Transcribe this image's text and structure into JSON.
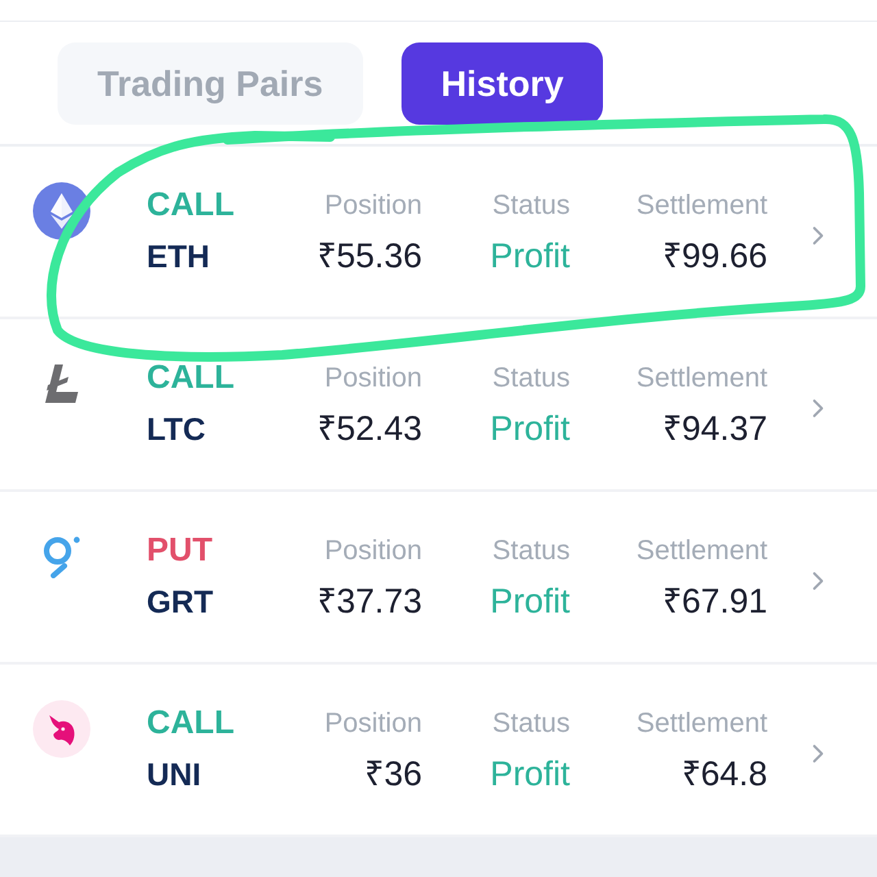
{
  "tabs": [
    {
      "label": "Trading Pairs",
      "selected": false
    },
    {
      "label": "History",
      "selected": true
    }
  ],
  "history": [
    {
      "kind": "diamond",
      "side": {
        "label": "CALL",
        "kind": "call"
      },
      "symbol": "ETH",
      "position_label": "Position",
      "position": "₹55.36",
      "status_label": "Status",
      "status": "Profit",
      "settlement_label": "Settlement",
      "settlement": "₹99.66",
      "highlighted": true
    },
    {
      "kind": "struck",
      "side": {
        "label": "CALL",
        "kind": "call"
      },
      "symbol": "LTC",
      "position_label": "Position",
      "position": "₹52.43",
      "status_label": "Status",
      "status": "Profit",
      "settlement_label": "Settlement",
      "settlement": "₹94.37",
      "highlighted": false
    },
    {
      "kind": "ring",
      "side": {
        "label": "PUT",
        "kind": "put"
      },
      "symbol": "GRT",
      "position_label": "Position",
      "position": "₹37.73",
      "status_label": "Status",
      "status": "Profit",
      "settlement_label": "Settlement",
      "settlement": "₹67.91",
      "highlighted": false
    },
    {
      "kind": "unicorn",
      "side": {
        "label": "CALL",
        "kind": "call"
      },
      "symbol": "UNI",
      "position_label": "Position",
      "position": "₹36",
      "status_label": "Status",
      "status": "Profit",
      "settlement_label": "Settlement",
      "settlement": "₹64.8",
      "highlighted": false
    }
  ]
}
